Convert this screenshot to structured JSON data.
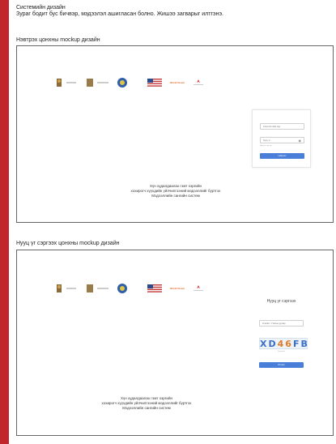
{
  "doc": {
    "title": "Системийн дизайн",
    "subtitle": "Зураг бодит бус бичвэр, мэдээлэл ашигласан болно. Жишээ загварыг илтгэнэ."
  },
  "sections": {
    "login": {
      "label": "Нэвтрэх цонхны mockup дизайн"
    },
    "reset": {
      "label": "Нууц үг сэргээх цонхны mockup дизайн"
    }
  },
  "caption": {
    "line1": "Хүн худалдаалах гэмт хэргийн",
    "line2": "хохирогч хүүхдийн үйлчилгээний мэдээллийг бүртгэх",
    "line3": "Мэдээллийн сангийн систем"
  },
  "logos": {
    "items": [
      "Mongolian emblem",
      "Ministry logo",
      "Agency seal",
      "US flag",
      "World Vision",
      "Partner logo"
    ],
    "world_vision": "World Vision"
  },
  "login_form": {
    "username_placeholder": "Хэрэглэгчийн нэр",
    "password_value": "Нууц үг",
    "forgot_link": "Нууц үг сэргээх",
    "submit_label": "Нэвтрэх"
  },
  "reset_form": {
    "heading": "Нууц үг сэргээх",
    "email_placeholder": "И-мэйл / Утасны дугаар",
    "captcha_text": "XD46FB",
    "captcha_caption": "Хүчинтэй",
    "submit_label": "Илгээх"
  },
  "colors": {
    "accent": "#4a7fd9",
    "frame": "#c0262b"
  }
}
